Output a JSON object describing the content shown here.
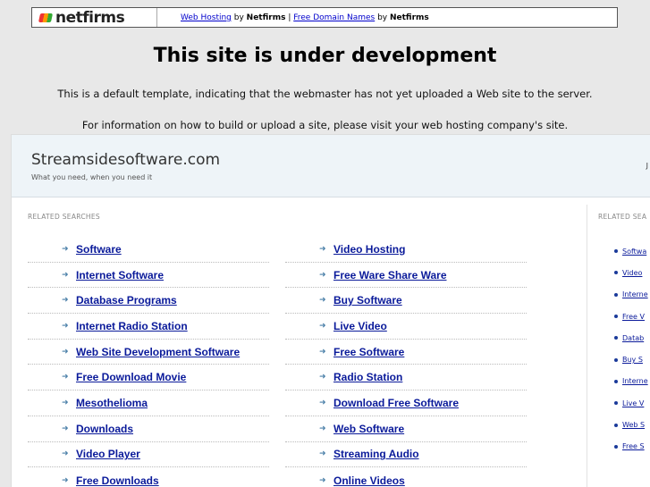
{
  "topbar": {
    "logo_text": "netfirms",
    "link1": "Web Hosting",
    "by1": " by ",
    "brand1": "Netfirms",
    "sep": " | ",
    "link2": "Free Domain Names",
    "by2": " by ",
    "brand2": "Netfirms"
  },
  "title": "This site is under development",
  "line1": "This is a default template, indicating that the webmaster has not yet uploaded a Web site to the server.",
  "line2": "For information on how to build or upload a site, please visit your web hosting company's site.",
  "frame": {
    "domain": "Streamsidesoftware.com",
    "tagline": "What you need, when you need it",
    "corner_text": "J",
    "related_label": "RELATED SEARCHES",
    "related_side_label": "RELATED SEA",
    "col_a": [
      "Software",
      "Internet Software",
      "Database Programs",
      "Internet Radio Station",
      "Web Site Development Software",
      "Free Download Movie",
      "Mesothelioma",
      "Downloads",
      "Video Player",
      "Free Downloads"
    ],
    "col_b": [
      "Video Hosting",
      "Free Ware Share Ware",
      "Buy Software",
      "Live Video",
      "Free Software",
      "Radio Station",
      "Download Free Software",
      "Web Software",
      "Streaming Audio",
      "Online Videos"
    ],
    "side": [
      "Softwa",
      "Video",
      "Interne",
      "Free V",
      "Datab",
      "Buy S",
      "Interne",
      "Live V",
      "Web S",
      "Free S"
    ]
  }
}
